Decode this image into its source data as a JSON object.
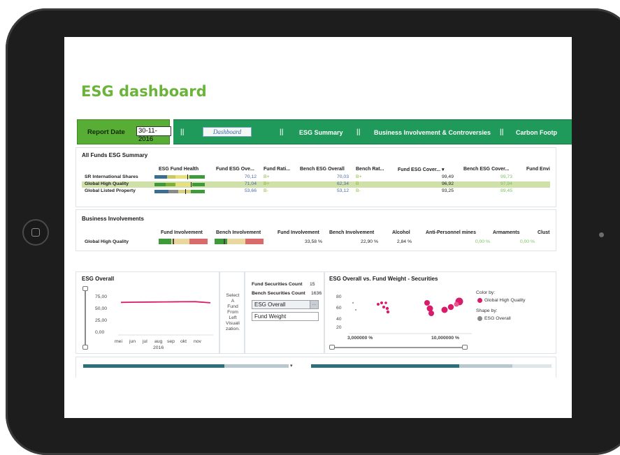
{
  "page": {
    "title": "ESG dashboard"
  },
  "top_bar": {
    "report_date_label": "Report Date",
    "report_date_value": "30-11-2016",
    "separator": "||",
    "tabs": [
      {
        "label": "Dashboard"
      },
      {
        "label": "ESG Summary"
      },
      {
        "label": "Business Involvement & Controversies"
      },
      {
        "label": "Carbon Footp"
      }
    ]
  },
  "summary": {
    "title": "All Funds ESG Summary",
    "headers": [
      "ESG Fund Health",
      "Fund ESG Ove...",
      "Fund Rati...",
      "Bench ESG Overall",
      "Bench Rat...",
      "Fund ESG Cover... ▾",
      "Bench ESG Cover...",
      "Fund Envi"
    ],
    "rows": [
      {
        "name": "SR International Shares",
        "fund_esg": "70,12",
        "fund_rating": "B+",
        "bench_esg": "70,03",
        "bench_rating": "B+",
        "fund_cov": "99,49",
        "bench_cov": "99,73"
      },
      {
        "name": "Global High Quality",
        "fund_esg": "71,04",
        "fund_rating": "B+",
        "bench_esg": "62,34",
        "bench_rating": "B",
        "fund_cov": "96,92",
        "bench_cov": "97,94"
      },
      {
        "name": "Global Listed Property",
        "fund_esg": "53,66",
        "fund_rating": "B-",
        "bench_esg": "53,12",
        "bench_rating": "B-",
        "fund_cov": "93,25",
        "bench_cov": "89,45"
      }
    ]
  },
  "business": {
    "title": "Business Involvements",
    "headers": [
      "Fund Involvement",
      "Bench Involvement",
      "Fund Involvement",
      "Bench Involvement",
      "Alcohol",
      "Anti-Personnel mines",
      "Armaments",
      "Clust"
    ],
    "row": {
      "name": "Global High Quality",
      "fund_inv": "33,58 %",
      "bench_inv": "22,90 %",
      "alcohol": "2,84 %",
      "mines": "0,00 %",
      "armaments": "0,00 %"
    }
  },
  "esg_overall": {
    "title": "ESG Overall",
    "y_ticks": [
      "75,00",
      "50,00",
      "25,00",
      "0,00"
    ],
    "x_ticks": [
      "mei",
      "jun",
      "jul",
      "aug",
      "sep",
      "okt",
      "nov"
    ],
    "year": "2016",
    "line_values": [
      73,
      73.5,
      73.8,
      74,
      74.3,
      74.5,
      72
    ]
  },
  "selector": {
    "message": "Select A Fund From Left Visualization.",
    "lines": [
      "Select",
      "A",
      "Fund",
      "From",
      "Left",
      "Visuali",
      "zation."
    ]
  },
  "counts": {
    "fund_label": "Fund Securities Count",
    "fund_value": "15",
    "bench_label": "Bench Securities Count",
    "bench_value": "1636",
    "dropdown_value": "ESG Overall",
    "dropdown_btn": "...",
    "field_value": "Fund Weight"
  },
  "scatter": {
    "title": "ESG Overall vs. Fund Weight - Securities",
    "y_ticks": [
      "80",
      "60",
      "40",
      "20"
    ],
    "x_ticks": [
      "3,000000 %",
      "10,000000 %"
    ],
    "color_by_label": "Color by:",
    "color_by_value": "Global High Quality",
    "shape_by_label": "Shape by:",
    "shape_by_value": "ESG Overall",
    "accent": "#d81b6a"
  },
  "colors": {
    "green": "#58ad34",
    "nav_green": "#1f9a5a",
    "title_green": "#6bb33a",
    "magenta": "#d81b6a",
    "teal": "#2a6f7a"
  }
}
